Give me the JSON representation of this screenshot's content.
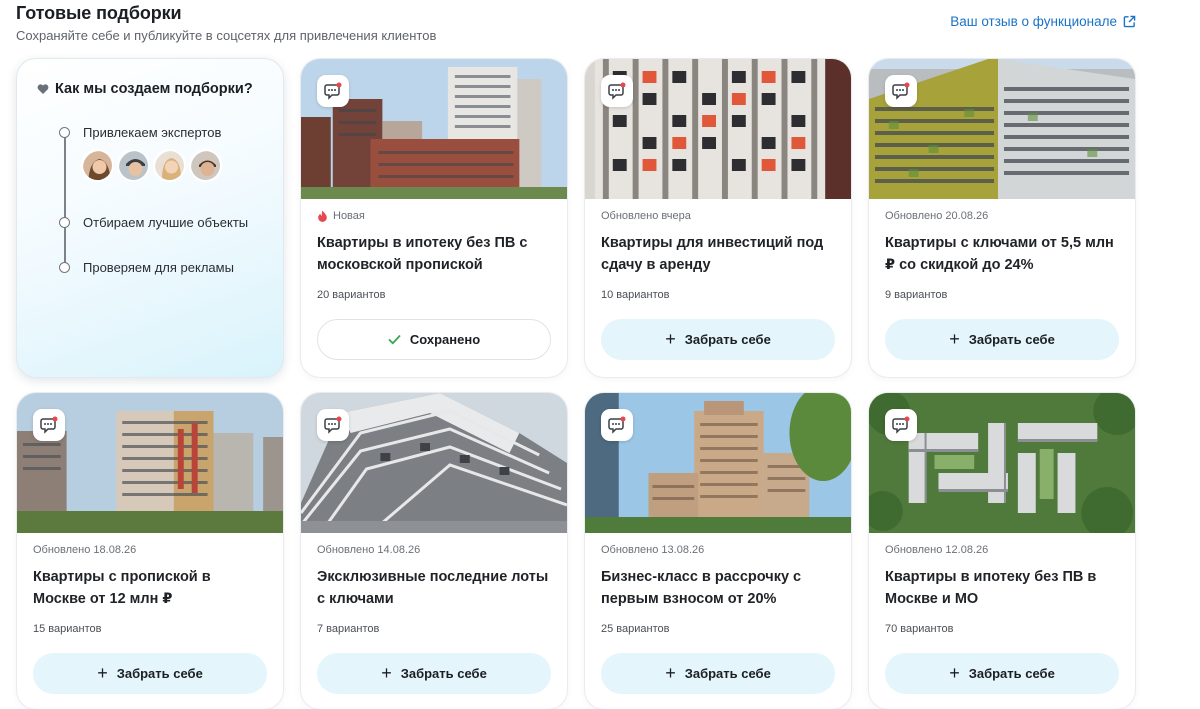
{
  "header": {
    "title": "Готовые подборки",
    "subtitle": "Сохраняйте себе и публикуйте в соцсетях для привлечения клиентов",
    "feedback_link": "Ваш отзыв о функционале"
  },
  "info": {
    "title": "Как мы создаем подборки?",
    "steps": [
      "Привлекаем экспертов",
      "Отбираем лучшие объекты",
      "Проверяем для рекламы"
    ]
  },
  "colors": {
    "accent": "#1a73c7",
    "button_bg": "#e4f5fc",
    "new_icon": "#e5484d",
    "check": "#3aa655"
  },
  "cards": [
    {
      "meta": "Новая",
      "title": "Квартиры в ипотеку без ПВ с московской пропиской",
      "count": "20 вариантов",
      "button": "Сохранено",
      "saved": true
    },
    {
      "meta": "Обновлено вчера",
      "title": "Квартиры для инвестиций под сдачу в аренду",
      "count": "10 вариантов",
      "button": "Забрать себе",
      "saved": false
    },
    {
      "meta": "Обновлено 20.08.26",
      "title": "Квартиры с ключами от 5,5 млн ₽ со скидкой до 24%",
      "count": "9 вариантов",
      "button": "Забрать себе",
      "saved": false
    },
    {
      "meta": "Обновлено 18.08.26",
      "title": "Квартиры с пропиской в Москве от 12 млн ₽",
      "count": "15 вариантов",
      "button": "Забрать себе",
      "saved": false
    },
    {
      "meta": "Обновлено 14.08.26",
      "title": "Эксклюзивные последние лоты с ключами",
      "count": "7 вариантов",
      "button": "Забрать себе",
      "saved": false
    },
    {
      "meta": "Обновлено 13.08.26",
      "title": "Бизнес-класс в рассрочку с первым взносом от 20%",
      "count": "25 вариантов",
      "button": "Забрать себе",
      "saved": false
    },
    {
      "meta": "Обновлено 12.08.26",
      "title": "Квартиры в ипотеку без ПВ в Москве и МО",
      "count": "70 вариантов",
      "button": "Забрать себе",
      "saved": false
    }
  ]
}
